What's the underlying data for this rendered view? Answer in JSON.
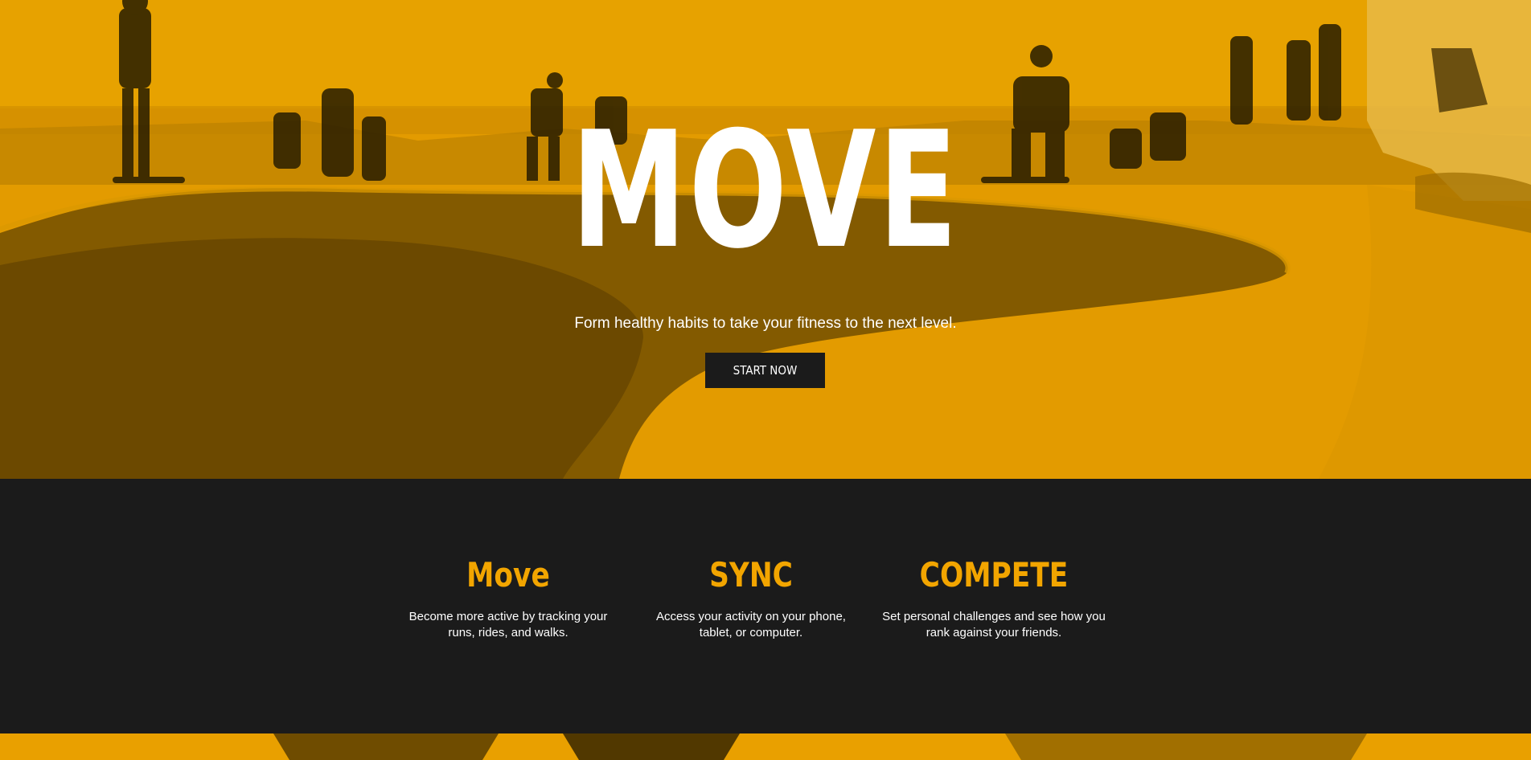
{
  "hero": {
    "title": "MOVE",
    "subtitle": "Form healthy habits to take your fitness to the next level.",
    "cta_label": "START NOW",
    "accent_color": "#f2a500",
    "button_color": "#1b1b1b"
  },
  "features": [
    {
      "title": "Move",
      "text": "Become more active by tracking your runs, rides, and walks."
    },
    {
      "title": "SYNC",
      "text": "Access your activity on your phone, tablet, or computer."
    },
    {
      "title": "COMPETE",
      "text": "Set personal challenges and see how you rank against your friends."
    }
  ],
  "colors": {
    "background_dark": "#1b1b1b",
    "text_light": "#ffffff"
  }
}
